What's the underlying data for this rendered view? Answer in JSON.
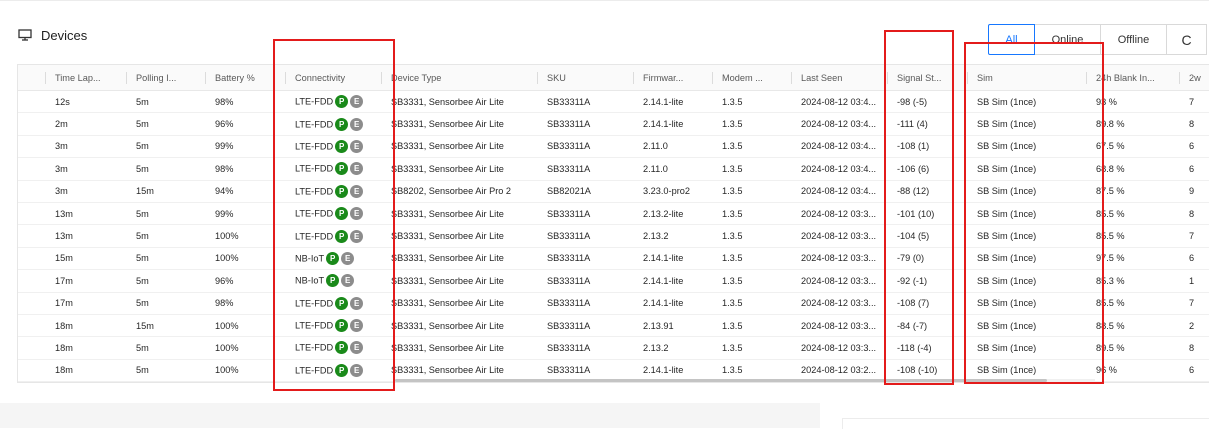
{
  "page": {
    "title": "Devices",
    "icon": "monitor-icon"
  },
  "filters": {
    "all": "All",
    "online": "Online",
    "offline": "Offline",
    "refresh_icon": "refresh-icon",
    "refresh_glyph": "C"
  },
  "table": {
    "columns": [
      "Time Lap...",
      "Polling I...",
      "Battery %",
      "Connectivity",
      "Device Type",
      "SKU",
      "Firmwar...",
      "Modem ...",
      "Last Seen",
      "Signal St...",
      "Sim",
      "24h Blank In...",
      "2w"
    ],
    "badges": {
      "p": "P",
      "e": "E"
    },
    "rows": [
      [
        "12s",
        "5m",
        "98%",
        "LTE-FDD",
        "SB3331, Sensorbee Air Lite",
        "SB33311A",
        "2.14.1-lite",
        "1.3.5",
        "2024-08-12 03:4...",
        "-98 (-5)",
        "SB Sim (1nce)",
        "93 %",
        "7"
      ],
      [
        "2m",
        "5m",
        "96%",
        "LTE-FDD",
        "SB3331, Sensorbee Air Lite",
        "SB33311A",
        "2.14.1-lite",
        "1.3.5",
        "2024-08-12 03:4...",
        "-111 (4)",
        "SB Sim (1nce)",
        "89.8 %",
        "8"
      ],
      [
        "3m",
        "5m",
        "99%",
        "LTE-FDD",
        "SB3331, Sensorbee Air Lite",
        "SB33311A",
        "2.11.0",
        "1.3.5",
        "2024-08-12 03:4...",
        "-108 (1)",
        "SB Sim (1nce)",
        "67.5 %",
        "6"
      ],
      [
        "3m",
        "5m",
        "98%",
        "LTE-FDD",
        "SB3331, Sensorbee Air Lite",
        "SB33311A",
        "2.11.0",
        "1.3.5",
        "2024-08-12 03:4...",
        "-106 (6)",
        "SB Sim (1nce)",
        "68.8 %",
        "6"
      ],
      [
        "3m",
        "15m",
        "94%",
        "LTE-FDD",
        "SB8202, Sensorbee Air Pro 2",
        "SB82021A",
        "3.23.0-pro2",
        "1.3.5",
        "2024-08-12 03:4...",
        "-88 (12)",
        "SB Sim (1nce)",
        "87.5 %",
        "9"
      ],
      [
        "13m",
        "5m",
        "99%",
        "LTE-FDD",
        "SB3331, Sensorbee Air Lite",
        "SB33311A",
        "2.13.2-lite",
        "1.3.5",
        "2024-08-12 03:3...",
        "-101 (10)",
        "SB Sim (1nce)",
        "85.5 %",
        "8"
      ],
      [
        "13m",
        "5m",
        "100%",
        "LTE-FDD",
        "SB3331, Sensorbee Air Lite",
        "SB33311A",
        "2.13.2",
        "1.3.5",
        "2024-08-12 03:3...",
        "-104 (5)",
        "SB Sim (1nce)",
        "85.5 %",
        "7"
      ],
      [
        "15m",
        "5m",
        "100%",
        "NB-IoT",
        "SB3331, Sensorbee Air Lite",
        "SB33311A",
        "2.14.1-lite",
        "1.3.5",
        "2024-08-12 03:3...",
        "-79 (0)",
        "SB Sim (1nce)",
        "97.5 %",
        "6"
      ],
      [
        "17m",
        "5m",
        "96%",
        "NB-IoT",
        "SB3331, Sensorbee Air Lite",
        "SB33311A",
        "2.14.1-lite",
        "1.3.5",
        "2024-08-12 03:3...",
        "-92 (-1)",
        "SB Sim (1nce)",
        "85.3 %",
        "1"
      ],
      [
        "17m",
        "5m",
        "98%",
        "LTE-FDD",
        "SB3331, Sensorbee Air Lite",
        "SB33311A",
        "2.14.1-lite",
        "1.3.5",
        "2024-08-12 03:3...",
        "-108 (7)",
        "SB Sim (1nce)",
        "85.5 %",
        "7"
      ],
      [
        "18m",
        "15m",
        "100%",
        "LTE-FDD",
        "SB3331, Sensorbee Air Lite",
        "SB33311A",
        "2.13.91",
        "1.3.5",
        "2024-08-12 03:3...",
        "-84 (-7)",
        "SB Sim (1nce)",
        "88.5 %",
        "2"
      ],
      [
        "18m",
        "5m",
        "100%",
        "LTE-FDD",
        "SB3331, Sensorbee Air Lite",
        "SB33311A",
        "2.13.2",
        "1.3.5",
        "2024-08-12 03:3...",
        "-118 (-4)",
        "SB Sim (1nce)",
        "89.5 %",
        "8"
      ],
      [
        "18m",
        "5m",
        "100%",
        "LTE-FDD",
        "SB3331, Sensorbee Air Lite",
        "SB33311A",
        "2.14.1-lite",
        "1.3.5",
        "2024-08-12 03:2...",
        "-108 (-10)",
        "SB Sim (1nce)",
        "96 %",
        "6"
      ]
    ]
  },
  "colors": {
    "accent": "#1677ff",
    "badge_p": "#1a8a1a",
    "badge_e": "#8c8c8c",
    "highlight": "#e31b1b"
  }
}
